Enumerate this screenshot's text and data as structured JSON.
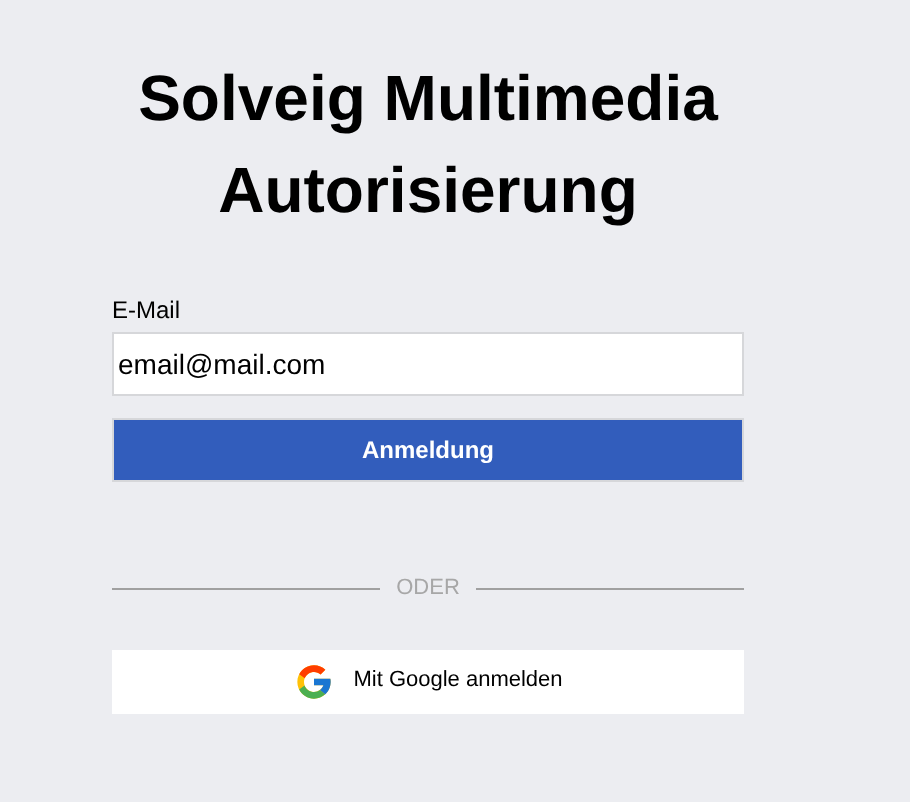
{
  "title": "Solveig Multimedia Autorisierung",
  "email_field": {
    "label": "E-Mail",
    "value": "email@mail.com"
  },
  "submit_button": "Anmeldung",
  "divider": "ODER",
  "google_button": "Mit Google anmelden"
}
